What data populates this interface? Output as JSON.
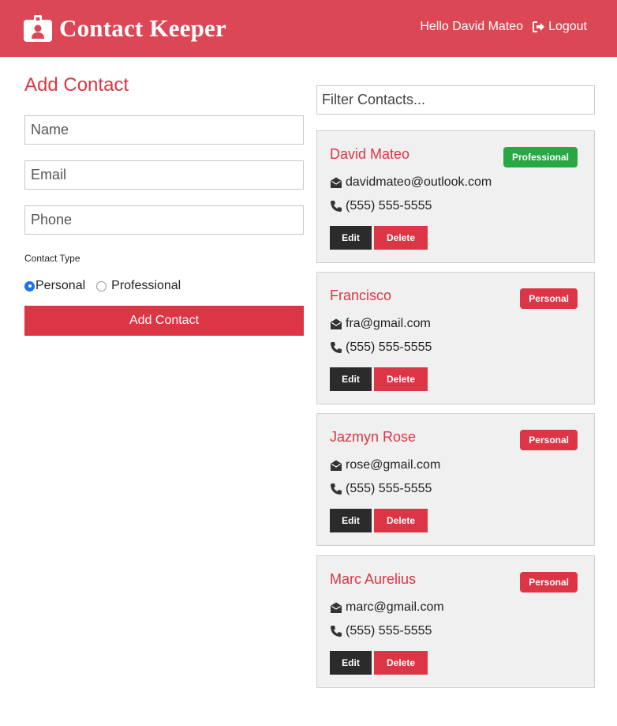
{
  "navbar": {
    "title": "Contact Keeper",
    "greeting": "Hello David Mateo",
    "logout_label": "Logout",
    "background": "#dc4756"
  },
  "form": {
    "title": "Add Contact",
    "name_placeholder": "Name",
    "email_placeholder": "Email",
    "phone_placeholder": "Phone",
    "type_label": "Contact Type",
    "type_options": [
      {
        "label": "Personal",
        "checked": true
      },
      {
        "label": "Professional",
        "checked": false
      }
    ],
    "submit_label": "Add Contact"
  },
  "filter": {
    "placeholder": "Filter Contacts..."
  },
  "contacts": [
    {
      "name": "David Mateo",
      "type": "Professional",
      "email": "davidmateo@outlook.com",
      "phone": "(555) 555-5555",
      "edit_label": "Edit",
      "delete_label": "Delete"
    },
    {
      "name": "Francisco",
      "type": "Personal",
      "email": "fra@gmail.com",
      "phone": "(555) 555-5555",
      "edit_label": "Edit",
      "delete_label": "Delete"
    },
    {
      "name": "Jazmyn Rose",
      "type": "Personal",
      "email": "rose@gmail.com",
      "phone": "(555) 555-5555",
      "edit_label": "Edit",
      "delete_label": "Delete"
    },
    {
      "name": "Marc Aurelius",
      "type": "Personal",
      "email": "marc@gmail.com",
      "phone": "(555) 555-5555",
      "edit_label": "Edit",
      "delete_label": "Delete"
    }
  ],
  "colors": {
    "primary": "#dc3545",
    "professional": "#28a745",
    "dark": "#2b2b2b"
  },
  "icons": {
    "brand": "id-badge-icon",
    "logout": "sign-out-icon",
    "email": "envelope-open-icon",
    "phone": "phone-icon"
  }
}
